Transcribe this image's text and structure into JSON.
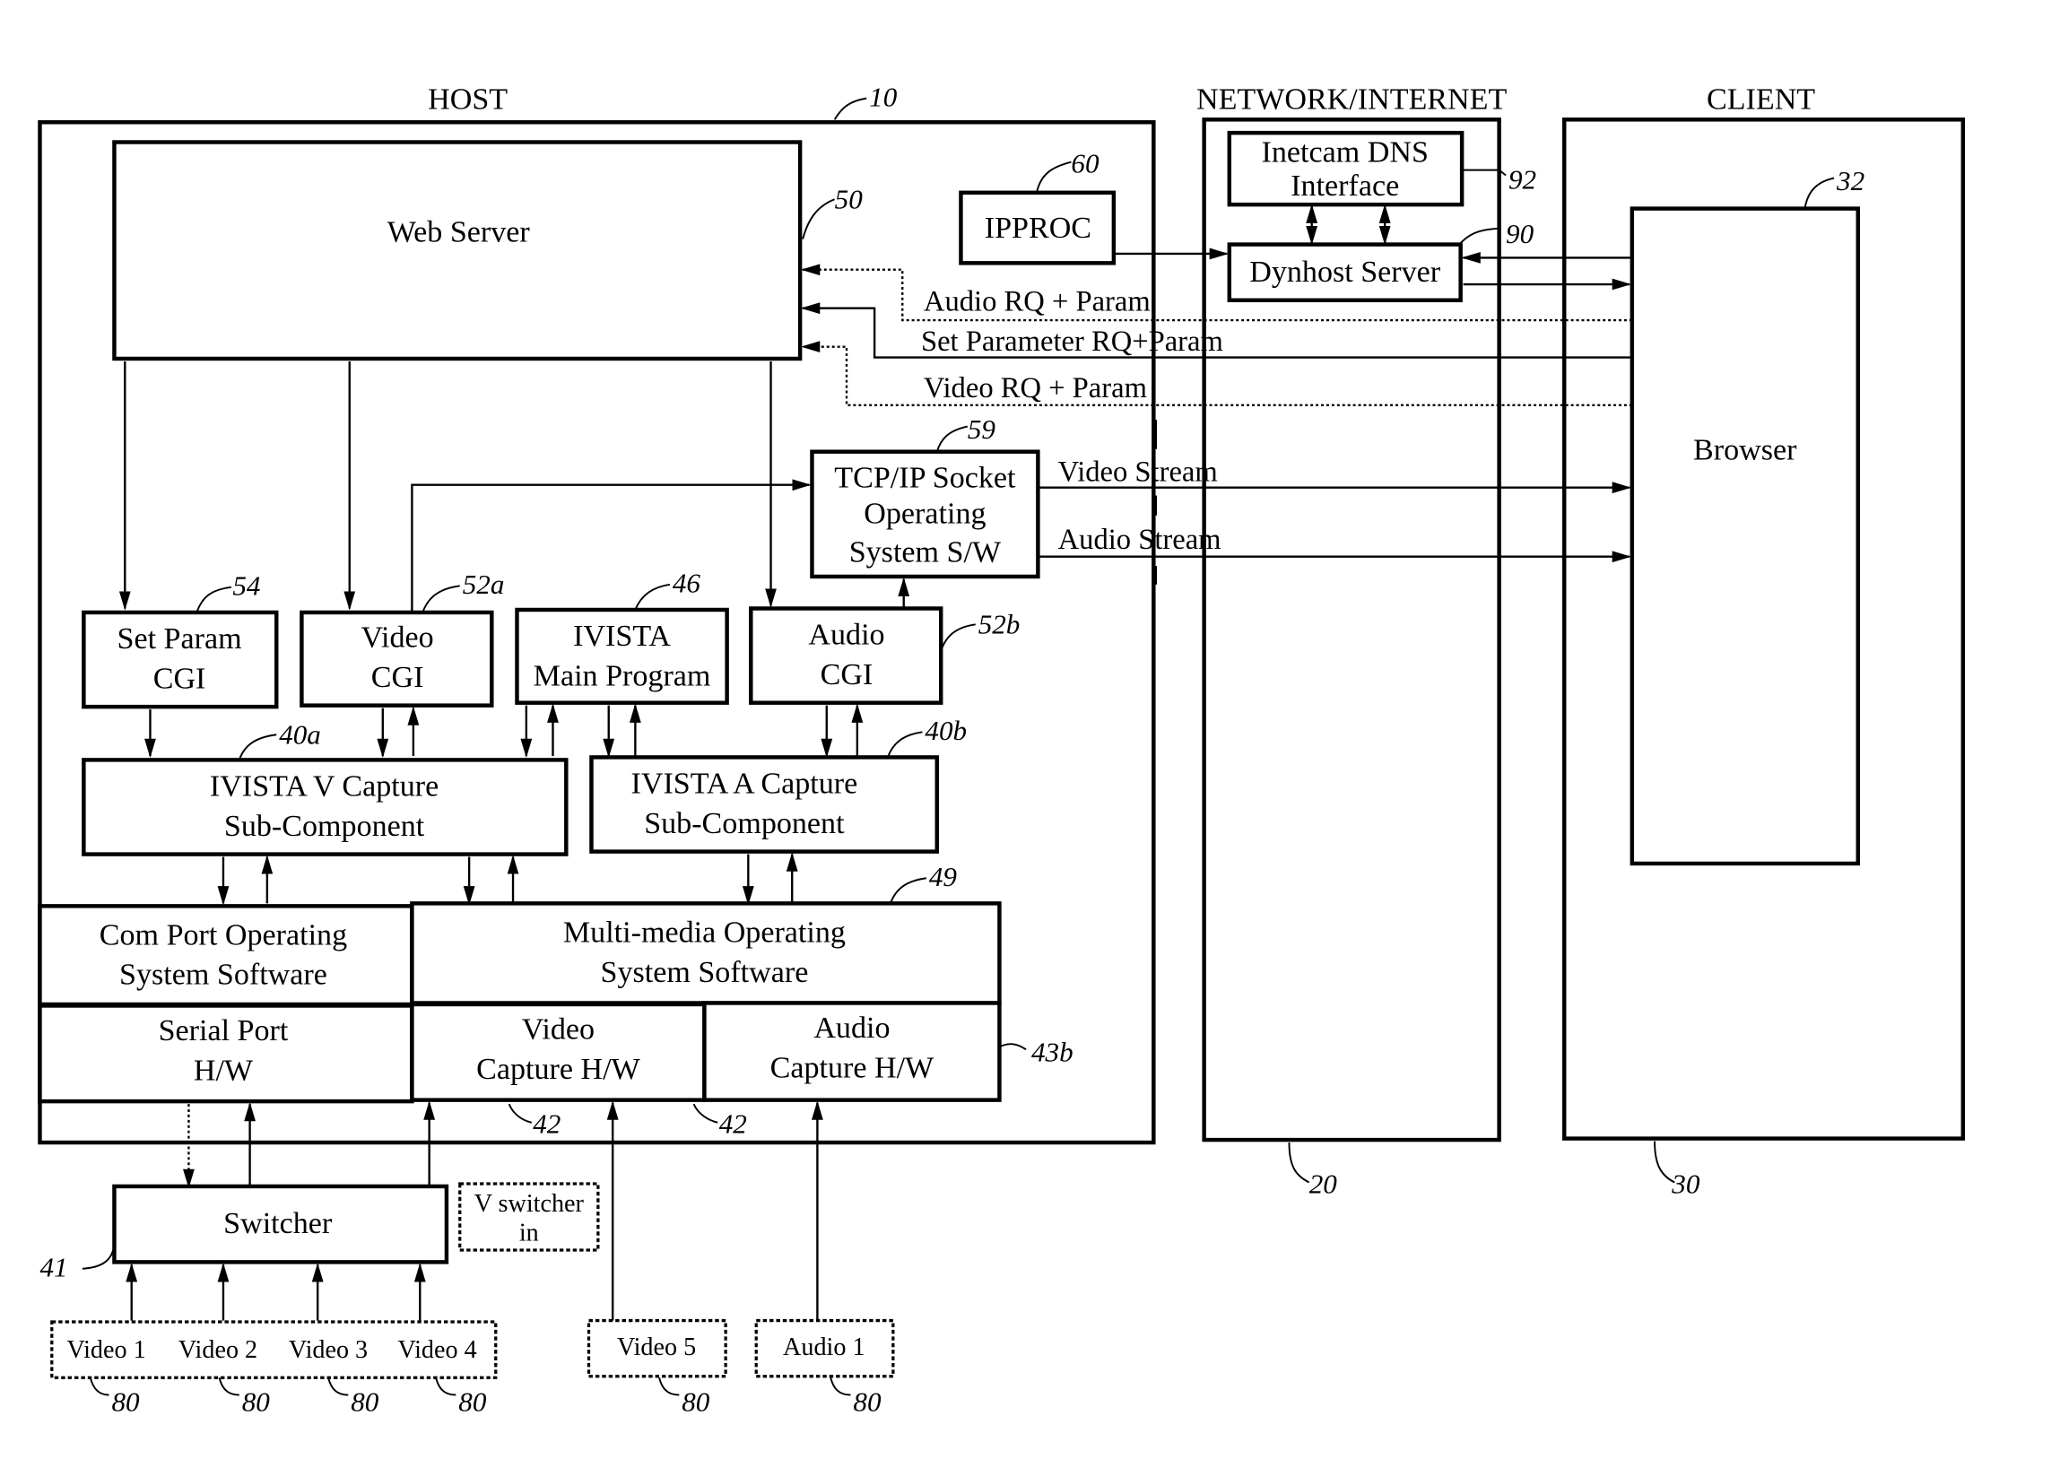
{
  "sections": {
    "host": {
      "title": "HOST",
      "ref": "10"
    },
    "network": {
      "title": "NETWORK/INTERNET",
      "ref": "20"
    },
    "client": {
      "title": "CLIENT",
      "ref": "30"
    }
  },
  "blocks": {
    "web_server": {
      "label": "Web Server",
      "ref": "50"
    },
    "ipproc": {
      "label": "IPPROC",
      "ref": "60"
    },
    "inetcam_dns": {
      "line1": "Inetcam DNS",
      "line2": "Interface",
      "ref": "92"
    },
    "dynhost": {
      "label": "Dynhost Server",
      "ref": "90"
    },
    "browser": {
      "label": "Browser",
      "ref": "32"
    },
    "tcpip": {
      "line1": "TCP/IP Socket",
      "line2": "Operating",
      "line3": "System S/W",
      "ref": "59"
    },
    "set_param_cgi": {
      "line1": "Set Param",
      "line2": "CGI",
      "ref": "54"
    },
    "video_cgi": {
      "line1": "Video",
      "line2": "CGI",
      "ref": "52a"
    },
    "ivista_main": {
      "line1": "IVISTA",
      "line2": "Main Program",
      "ref": "46"
    },
    "audio_cgi": {
      "line1": "Audio",
      "line2": "CGI",
      "ref": "52b"
    },
    "ivista_v": {
      "line1": "IVISTA V Capture",
      "line2": "Sub-Component",
      "ref": "40a"
    },
    "ivista_a": {
      "line1": "IVISTA A Capture",
      "line2": "Sub-Component",
      "ref": "40b"
    },
    "com_port_os": {
      "line1": "Com Port Operating",
      "line2": "System Software"
    },
    "multimedia_os": {
      "line1": "Multi-media Operating",
      "line2": "System Software",
      "ref": "49"
    },
    "serial_port_hw": {
      "line1": "Serial Port",
      "line2": "H/W"
    },
    "video_capture_hw": {
      "line1": "Video",
      "line2": "Capture H/W",
      "ref": "42"
    },
    "audio_capture_hw": {
      "line1": "Audio",
      "line2": "Capture H/W",
      "ref": "43b",
      "ref2": "42"
    },
    "switcher": {
      "label": "Switcher",
      "ref": "41"
    },
    "v_switcher_in": {
      "line1": "V switcher",
      "line2": "in"
    },
    "video_sources": {
      "items": [
        "Video 1",
        "Video 2",
        "Video 3",
        "Video 4"
      ],
      "ref": "80"
    },
    "video5": {
      "label": "Video 5",
      "ref": "80"
    },
    "audio1": {
      "label": "Audio 1",
      "ref": "80"
    }
  },
  "flows": {
    "audio_rq": "Audio RQ + Param",
    "set_param_rq": "Set Parameter RQ+Param",
    "video_rq": "Video RQ + Param",
    "video_stream": "Video Stream",
    "audio_stream": "Audio Stream"
  }
}
